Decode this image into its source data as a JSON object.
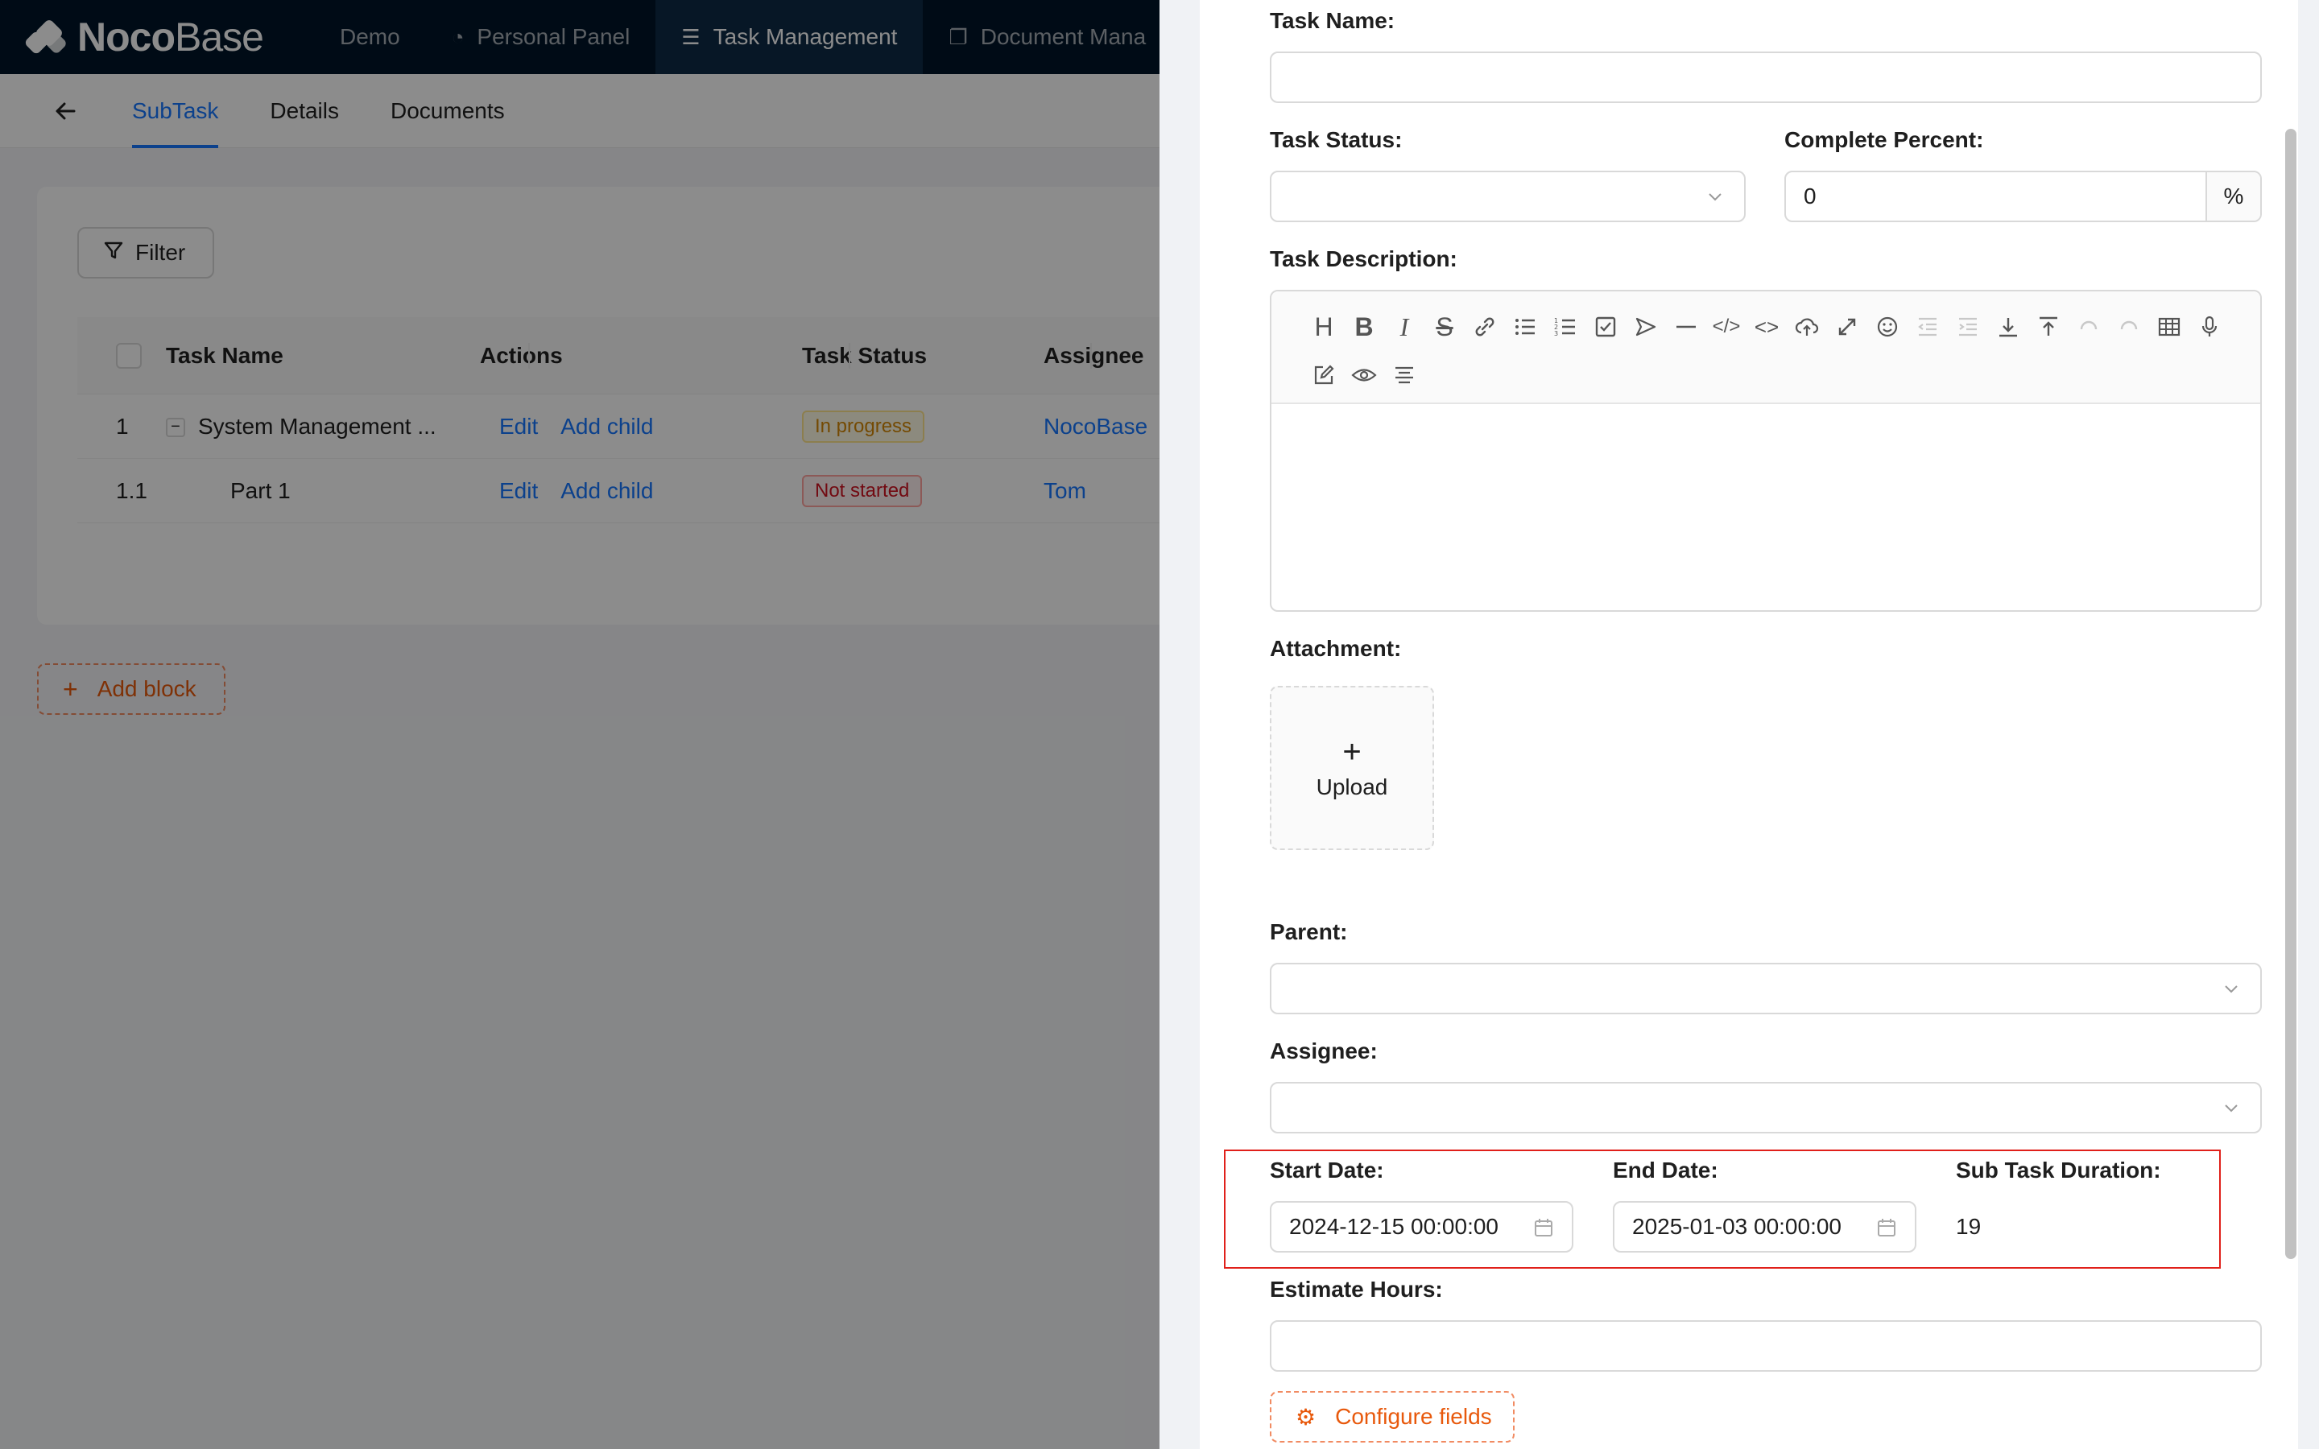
{
  "topbar": {
    "logo_bold": "Noco",
    "logo_light": "Base",
    "nav": [
      {
        "label": "Demo",
        "icon": ""
      },
      {
        "label": "Personal Panel",
        "icon": "pie-chart-icon"
      },
      {
        "label": "Task Management",
        "icon": "list-icon"
      },
      {
        "label": "Document Mana",
        "icon": "document-icon"
      }
    ]
  },
  "subnav": {
    "tabs": [
      "SubTask",
      "Details",
      "Documents"
    ]
  },
  "table": {
    "filter_label": "Filter",
    "columns": [
      "Task Name",
      "Actions",
      "Task Status",
      "Assignee"
    ],
    "rows": [
      {
        "index": "1",
        "name": "System Management ...",
        "edit": "Edit",
        "add_child": "Add child",
        "status": "In progress",
        "assignee": "NocoBase"
      },
      {
        "index": "1.1",
        "name": "Part 1",
        "edit": "Edit",
        "add_child": "Add child",
        "status": "Not started",
        "assignee": "Tom"
      }
    ]
  },
  "add_block_label": "Add block",
  "form": {
    "task_name": {
      "label": "Task Name:",
      "value": ""
    },
    "task_status": {
      "label": "Task Status:",
      "value": ""
    },
    "complete_percent": {
      "label": "Complete Percent:",
      "value": "0",
      "suffix": "%"
    },
    "task_description": {
      "label": "Task Description:"
    },
    "attachment": {
      "label": "Attachment:",
      "upload_label": "Upload"
    },
    "parent": {
      "label": "Parent:",
      "value": ""
    },
    "assignee": {
      "label": "Assignee:",
      "value": ""
    },
    "start_date": {
      "label": "Start Date:",
      "value": "2024-12-15 00:00:00"
    },
    "end_date": {
      "label": "End Date:",
      "value": "2025-01-03 00:00:00"
    },
    "sub_task_duration": {
      "label": "Sub Task Duration:",
      "value": "19"
    },
    "estimate_hours": {
      "label": "Estimate Hours:",
      "value": ""
    },
    "configure_fields_label": "Configure fields"
  },
  "colors": {
    "primary": "#1677ff",
    "accent_orange": "#e8590c",
    "highlight_red": "#e0201a",
    "topbar": "#001529"
  }
}
